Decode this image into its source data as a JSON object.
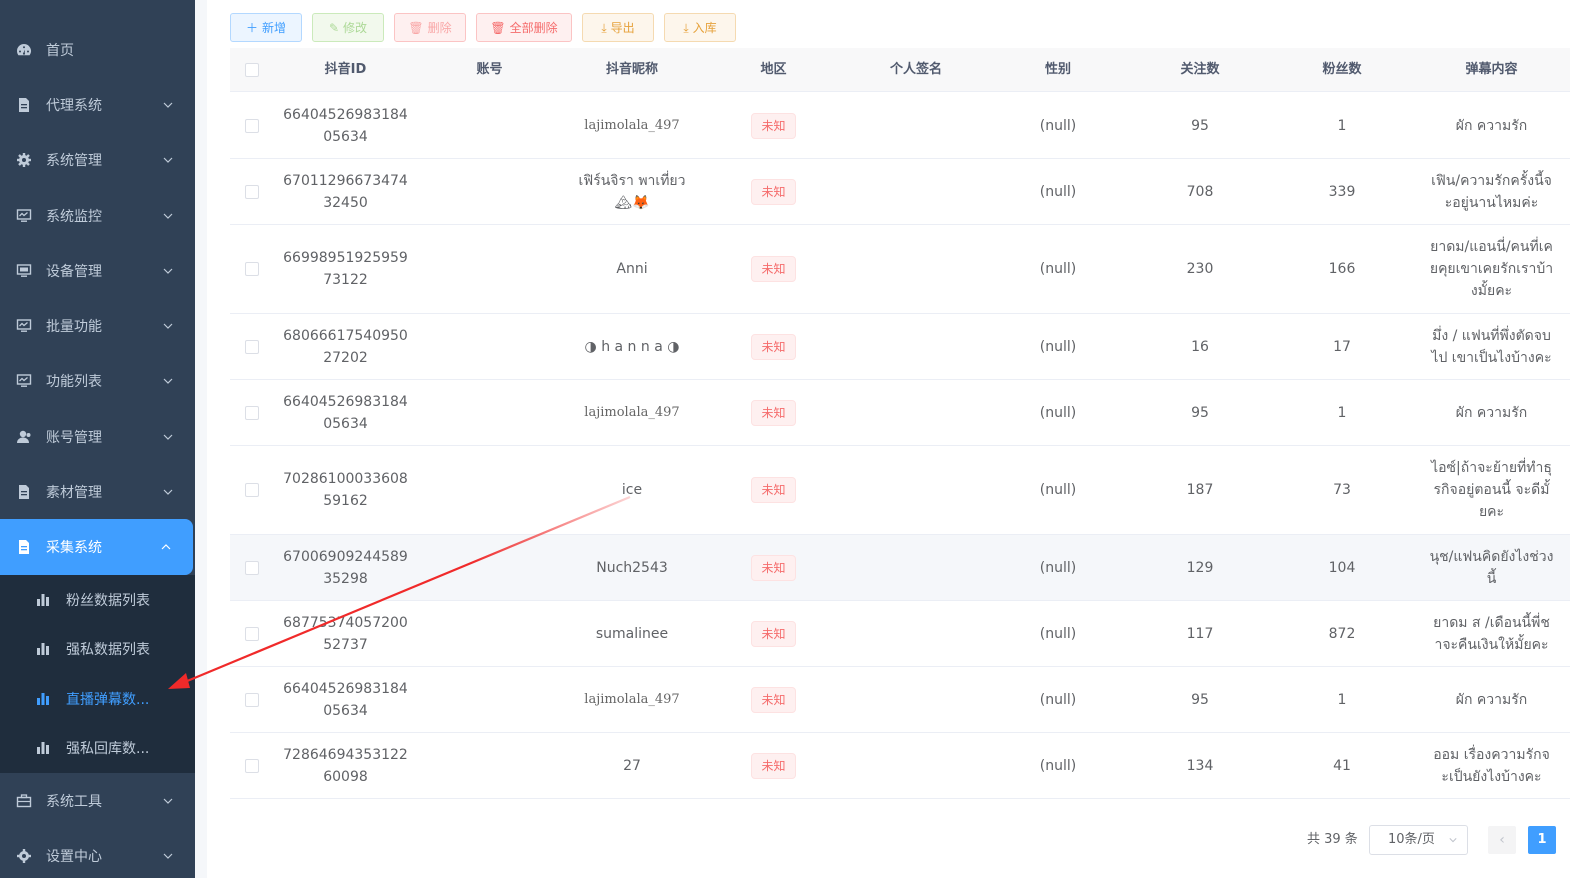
{
  "sidebar": {
    "items": [
      {
        "label": "首页",
        "icon": "dashboard-icon",
        "arrow": false
      },
      {
        "label": "代理系统",
        "icon": "document-icon",
        "arrow": true
      },
      {
        "label": "系统管理",
        "icon": "gear-icon",
        "arrow": true
      },
      {
        "label": "系统监控",
        "icon": "monitor-icon",
        "arrow": true
      },
      {
        "label": "设备管理",
        "icon": "monitor-icon",
        "arrow": true
      },
      {
        "label": "批量功能",
        "icon": "monitor-icon",
        "arrow": true
      },
      {
        "label": "功能列表",
        "icon": "monitor-icon",
        "arrow": true
      },
      {
        "label": "账号管理",
        "icon": "user-icon",
        "arrow": true
      },
      {
        "label": "素材管理",
        "icon": "document-icon",
        "arrow": true
      },
      {
        "label": "采集系统",
        "icon": "document-icon",
        "arrow": true,
        "expanded": true
      },
      {
        "label": "系统工具",
        "icon": "toolbox-icon",
        "arrow": true
      },
      {
        "label": "设置中心",
        "icon": "gear-icon",
        "arrow": true
      }
    ],
    "sub_items": [
      {
        "label": "粉丝数据列表",
        "icon": "bar-chart-icon"
      },
      {
        "label": "强私数据列表",
        "icon": "bar-chart-icon"
      },
      {
        "label": "直播弹幕数...",
        "icon": "bar-chart-icon",
        "active": true
      },
      {
        "label": "强私回库数...",
        "icon": "bar-chart-icon"
      }
    ]
  },
  "toolbar": {
    "add_label": "新增",
    "edit_label": "修改",
    "delete_label": "删除",
    "delete_all_label": "全部删除",
    "export_label": "导出",
    "import_label": "入库"
  },
  "table": {
    "headers": {
      "id": "抖音ID",
      "account": "账号",
      "nickname": "抖音昵称",
      "region": "地区",
      "signature": "个人签名",
      "gender": "性别",
      "following": "关注数",
      "fans": "粉丝数",
      "content": "弹幕内容"
    },
    "rows": [
      {
        "id": "6640452698318405634",
        "account": "",
        "nickname": "lajimolala_497",
        "region": "未知",
        "signature": "",
        "gender": "(null)",
        "following": "95",
        "fans": "1",
        "content": "ผัก ความรัก"
      },
      {
        "id": "6701129667347432450",
        "account": "",
        "nickname": "เฟิร์นจิรา พาเที่ยว 🏔🦊",
        "region": "未知",
        "signature": "",
        "gender": "(null)",
        "following": "708",
        "fans": "339",
        "content": "เฟิน/ความรักครั้งนี้จะอยู่นานไหมค่ะ"
      },
      {
        "id": "6699895192595973122",
        "account": "",
        "nickname": "Anni",
        "region": "未知",
        "signature": "",
        "gender": "(null)",
        "following": "230",
        "fans": "166",
        "content": "ยาดม/แอนนี่/คนที่เคยคุยเขาเคยรักเราบ้างมั้ยคะ"
      },
      {
        "id": "6806661754095027202",
        "account": "",
        "nickname": "◑ h a n n a ◑",
        "region": "未知",
        "signature": "",
        "gender": "(null)",
        "following": "16",
        "fans": "17",
        "content": "มึ่ง / แฟนที่พึ่งตัดจบไป เขาเป็นไงบ้างคะ"
      },
      {
        "id": "6640452698318405634",
        "account": "",
        "nickname": "lajimolala_497",
        "region": "未知",
        "signature": "",
        "gender": "(null)",
        "following": "95",
        "fans": "1",
        "content": "ผัก ความรัก"
      },
      {
        "id": "7028610003360859162",
        "account": "",
        "nickname": "ice",
        "region": "未知",
        "signature": "",
        "gender": "(null)",
        "following": "187",
        "fans": "73",
        "content": "ไอซ์|ถ้าจะย้ายที่ทำธุรกิจอยู่ตอนนี้ จะดีมั้ยคะ"
      },
      {
        "id": "6700690924458935298",
        "account": "",
        "nickname": "Nuch2543",
        "region": "未知",
        "signature": "",
        "gender": "(null)",
        "following": "129",
        "fans": "104",
        "content": "นุช/แฟนคิดยังไงช่วงนี้"
      },
      {
        "id": "6877537405720052737",
        "account": "",
        "nickname": "sumalinee",
        "region": "未知",
        "signature": "",
        "gender": "(null)",
        "following": "117",
        "fans": "872",
        "content": "ยาดม ส /เดือนนี้พี่ชาจะคืนเงินให้มั้ยคะ"
      },
      {
        "id": "6640452698318405634",
        "account": "",
        "nickname": "lajimolala_497",
        "region": "未知",
        "signature": "",
        "gender": "(null)",
        "following": "95",
        "fans": "1",
        "content": "ผัก ความรัก"
      },
      {
        "id": "7286469435312260098",
        "account": "",
        "nickname": "27",
        "region": "未知",
        "signature": "",
        "gender": "(null)",
        "following": "134",
        "fans": "41",
        "content": "ออม เรื่องความรักจะเป็นยังไงบ้างคะ"
      }
    ]
  },
  "pagination": {
    "total_label": "共 39 条",
    "page_size": "10条/页",
    "prev": "‹",
    "current_page": "1"
  },
  "colors": {
    "sidebar_bg": "#304156",
    "accent": "#409eff",
    "danger": "#f56c6c",
    "arrow": "#f02a2a"
  }
}
